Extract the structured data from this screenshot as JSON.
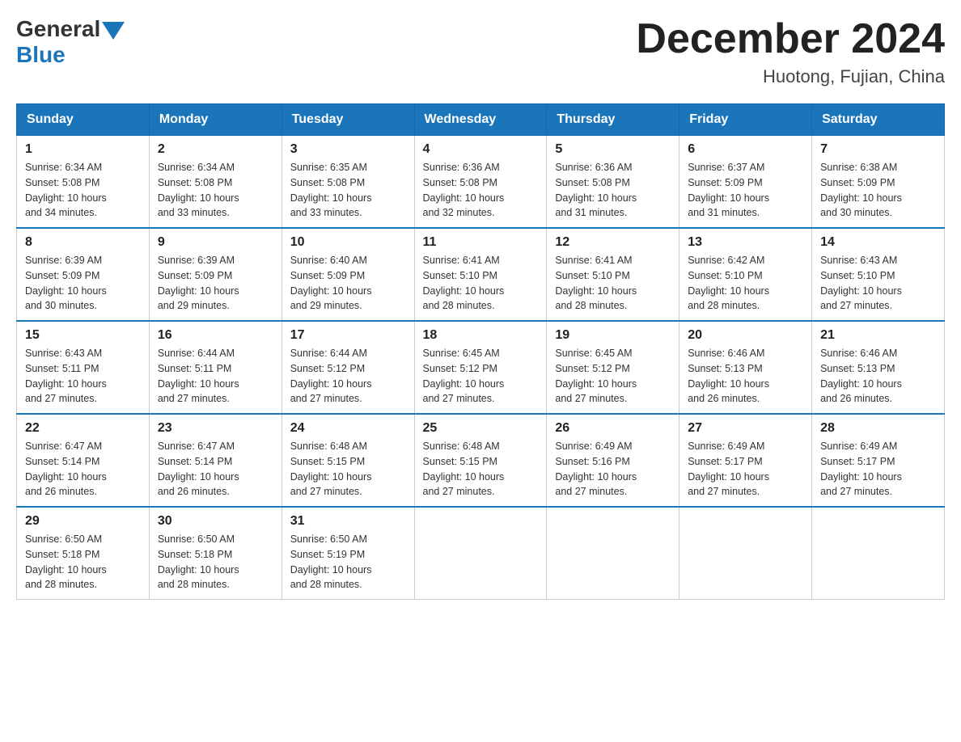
{
  "logo": {
    "general": "General",
    "blue": "Blue"
  },
  "title": "December 2024",
  "subtitle": "Huotong, Fujian, China",
  "days_of_week": [
    "Sunday",
    "Monday",
    "Tuesday",
    "Wednesday",
    "Thursday",
    "Friday",
    "Saturday"
  ],
  "weeks": [
    [
      {
        "day": "1",
        "sunrise": "6:34 AM",
        "sunset": "5:08 PM",
        "daylight": "10 hours and 34 minutes."
      },
      {
        "day": "2",
        "sunrise": "6:34 AM",
        "sunset": "5:08 PM",
        "daylight": "10 hours and 33 minutes."
      },
      {
        "day": "3",
        "sunrise": "6:35 AM",
        "sunset": "5:08 PM",
        "daylight": "10 hours and 33 minutes."
      },
      {
        "day": "4",
        "sunrise": "6:36 AM",
        "sunset": "5:08 PM",
        "daylight": "10 hours and 32 minutes."
      },
      {
        "day": "5",
        "sunrise": "6:36 AM",
        "sunset": "5:08 PM",
        "daylight": "10 hours and 31 minutes."
      },
      {
        "day": "6",
        "sunrise": "6:37 AM",
        "sunset": "5:09 PM",
        "daylight": "10 hours and 31 minutes."
      },
      {
        "day": "7",
        "sunrise": "6:38 AM",
        "sunset": "5:09 PM",
        "daylight": "10 hours and 30 minutes."
      }
    ],
    [
      {
        "day": "8",
        "sunrise": "6:39 AM",
        "sunset": "5:09 PM",
        "daylight": "10 hours and 30 minutes."
      },
      {
        "day": "9",
        "sunrise": "6:39 AM",
        "sunset": "5:09 PM",
        "daylight": "10 hours and 29 minutes."
      },
      {
        "day": "10",
        "sunrise": "6:40 AM",
        "sunset": "5:09 PM",
        "daylight": "10 hours and 29 minutes."
      },
      {
        "day": "11",
        "sunrise": "6:41 AM",
        "sunset": "5:10 PM",
        "daylight": "10 hours and 28 minutes."
      },
      {
        "day": "12",
        "sunrise": "6:41 AM",
        "sunset": "5:10 PM",
        "daylight": "10 hours and 28 minutes."
      },
      {
        "day": "13",
        "sunrise": "6:42 AM",
        "sunset": "5:10 PM",
        "daylight": "10 hours and 28 minutes."
      },
      {
        "day": "14",
        "sunrise": "6:43 AM",
        "sunset": "5:10 PM",
        "daylight": "10 hours and 27 minutes."
      }
    ],
    [
      {
        "day": "15",
        "sunrise": "6:43 AM",
        "sunset": "5:11 PM",
        "daylight": "10 hours and 27 minutes."
      },
      {
        "day": "16",
        "sunrise": "6:44 AM",
        "sunset": "5:11 PM",
        "daylight": "10 hours and 27 minutes."
      },
      {
        "day": "17",
        "sunrise": "6:44 AM",
        "sunset": "5:12 PM",
        "daylight": "10 hours and 27 minutes."
      },
      {
        "day": "18",
        "sunrise": "6:45 AM",
        "sunset": "5:12 PM",
        "daylight": "10 hours and 27 minutes."
      },
      {
        "day": "19",
        "sunrise": "6:45 AM",
        "sunset": "5:12 PM",
        "daylight": "10 hours and 27 minutes."
      },
      {
        "day": "20",
        "sunrise": "6:46 AM",
        "sunset": "5:13 PM",
        "daylight": "10 hours and 26 minutes."
      },
      {
        "day": "21",
        "sunrise": "6:46 AM",
        "sunset": "5:13 PM",
        "daylight": "10 hours and 26 minutes."
      }
    ],
    [
      {
        "day": "22",
        "sunrise": "6:47 AM",
        "sunset": "5:14 PM",
        "daylight": "10 hours and 26 minutes."
      },
      {
        "day": "23",
        "sunrise": "6:47 AM",
        "sunset": "5:14 PM",
        "daylight": "10 hours and 26 minutes."
      },
      {
        "day": "24",
        "sunrise": "6:48 AM",
        "sunset": "5:15 PM",
        "daylight": "10 hours and 27 minutes."
      },
      {
        "day": "25",
        "sunrise": "6:48 AM",
        "sunset": "5:15 PM",
        "daylight": "10 hours and 27 minutes."
      },
      {
        "day": "26",
        "sunrise": "6:49 AM",
        "sunset": "5:16 PM",
        "daylight": "10 hours and 27 minutes."
      },
      {
        "day": "27",
        "sunrise": "6:49 AM",
        "sunset": "5:17 PM",
        "daylight": "10 hours and 27 minutes."
      },
      {
        "day": "28",
        "sunrise": "6:49 AM",
        "sunset": "5:17 PM",
        "daylight": "10 hours and 27 minutes."
      }
    ],
    [
      {
        "day": "29",
        "sunrise": "6:50 AM",
        "sunset": "5:18 PM",
        "daylight": "10 hours and 28 minutes."
      },
      {
        "day": "30",
        "sunrise": "6:50 AM",
        "sunset": "5:18 PM",
        "daylight": "10 hours and 28 minutes."
      },
      {
        "day": "31",
        "sunrise": "6:50 AM",
        "sunset": "5:19 PM",
        "daylight": "10 hours and 28 minutes."
      },
      null,
      null,
      null,
      null
    ]
  ],
  "labels": {
    "sunrise": "Sunrise:",
    "sunset": "Sunset:",
    "daylight": "Daylight:"
  }
}
